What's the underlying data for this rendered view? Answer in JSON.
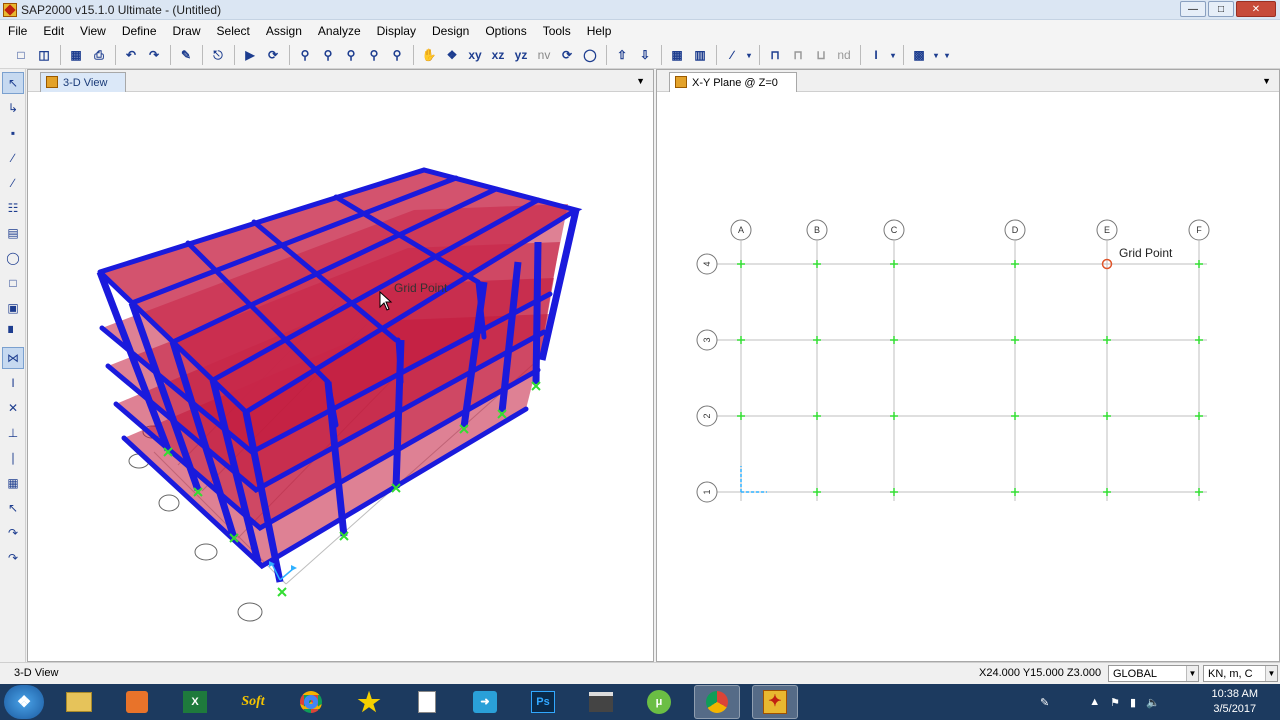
{
  "app": {
    "title": "SAP2000 v15.1.0 Ultimate  - (Untitled)"
  },
  "menu": [
    "File",
    "Edit",
    "View",
    "Define",
    "Draw",
    "Select",
    "Assign",
    "Analyze",
    "Display",
    "Design",
    "Options",
    "Tools",
    "Help"
  ],
  "toolbar": {
    "xy": "xy",
    "xz": "xz",
    "yz": "yz",
    "nv": "nv",
    "nd": "nd"
  },
  "panes": {
    "left": {
      "tab": "3-D View",
      "tooltip": "Grid Point"
    },
    "right": {
      "tab": "X-Y Plane @ Z=0",
      "tooltip": "Grid Point"
    }
  },
  "grid": {
    "x_labels": [
      "A",
      "B",
      "C",
      "D",
      "E",
      "F"
    ],
    "y_labels": [
      "4",
      "3",
      "2",
      "1"
    ]
  },
  "status": {
    "view": "3-D View",
    "coords": "X24.000  Y15.000  Z3.000",
    "coord_system": "GLOBAL",
    "units": "KN, m, C"
  },
  "taskbar": {
    "time": "10:38 AM",
    "date": "3/5/2017",
    "soft_label": "Soft"
  },
  "colors": {
    "beam": "#1a1adc",
    "slab": "#c21a3c",
    "grid_line": "#bfbfbf",
    "support": "#33dd33",
    "selected_point": "#e0552a"
  }
}
